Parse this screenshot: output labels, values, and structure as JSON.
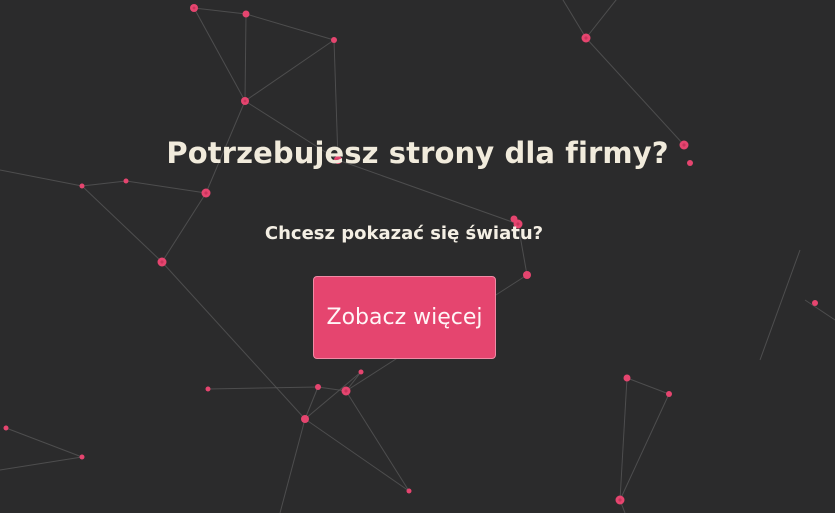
{
  "hero": {
    "headline": "Potrzebujesz strony dla firmy?",
    "subheadline": "Chcesz pokazać się światu?",
    "cta_label": "Zobacz więcej"
  },
  "background": {
    "style": "particle-network",
    "color": "#2b2b2c",
    "node_color": "#e5456f",
    "link_color": "#5a5a5a"
  },
  "colors": {
    "text": "#f1ebdc",
    "accent": "#e5456f"
  }
}
